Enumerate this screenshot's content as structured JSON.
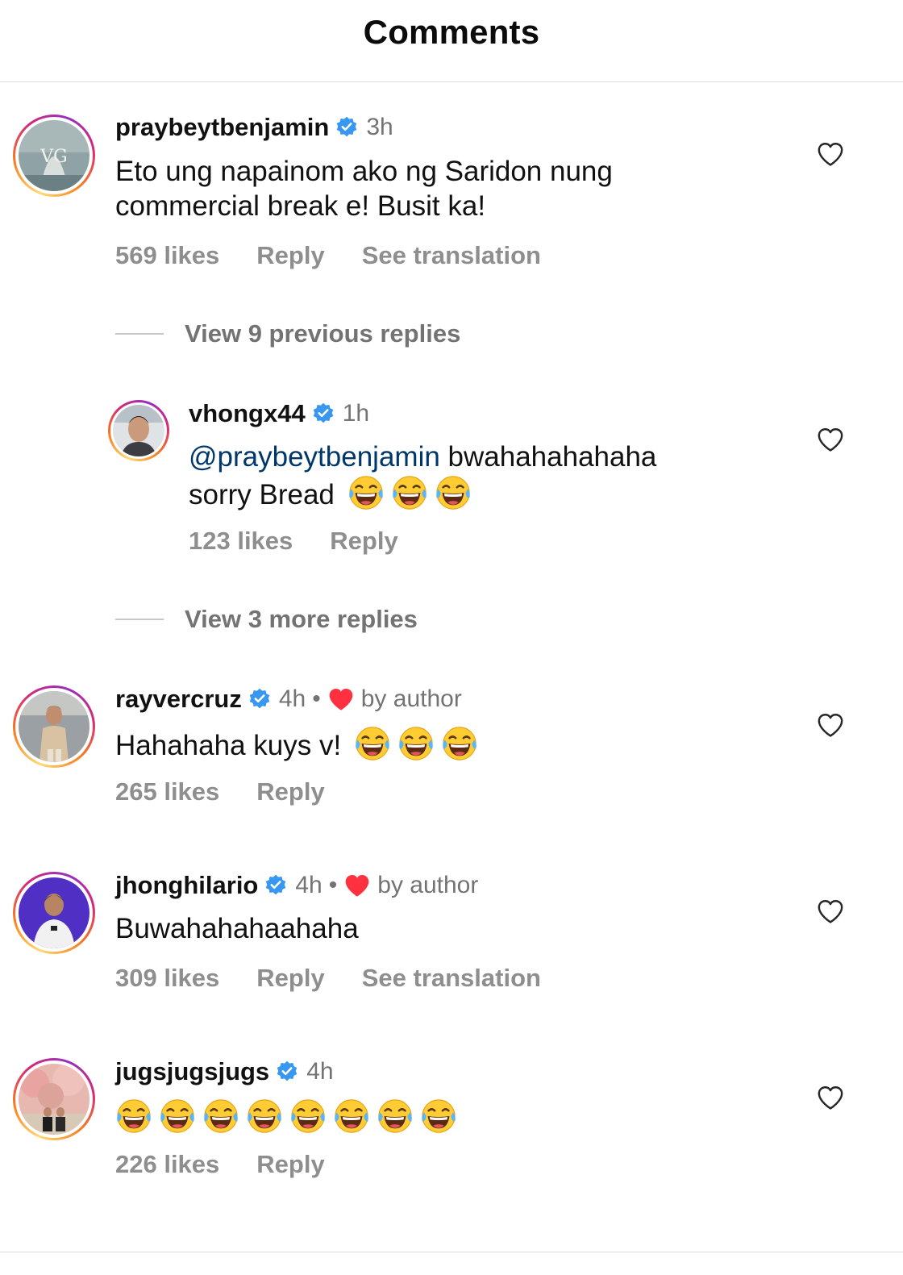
{
  "header": {
    "title": "Comments"
  },
  "comments": [
    {
      "username": "praybeytbenjamin",
      "time": "3h",
      "text": "Eto ung napainom ako ng Saridon nung commercial break e! Busit ka!",
      "text_line1": "Eto ung napainom ako ng Saridon nung",
      "text_line2": "commercial break e! Busit ka!",
      "likes": "569 likes",
      "reply": "Reply",
      "translation": "See translation"
    },
    {
      "view_previous": "View 9 previous replies"
    },
    {
      "username": "vhongx44",
      "time": "1h",
      "mention": "@praybeytbenjamin",
      "text_after_mention": " bwahahahahaha",
      "text_line2": "sorry Bread",
      "emoji_count": 3,
      "likes": "123 likes",
      "reply": "Reply"
    },
    {
      "view_more": "View 3 more replies"
    },
    {
      "username": "rayvercruz",
      "time": "4h",
      "dot": "•",
      "by_author": "by author",
      "text": "Hahahaha kuys v!",
      "emoji_count": 3,
      "likes": "265 likes",
      "reply": "Reply"
    },
    {
      "username": "jhonghilario",
      "time": "4h",
      "dot": "•",
      "by_author": "by author",
      "text": "Buwahahahaahaha",
      "likes": "309 likes",
      "reply": "Reply",
      "translation": "See translation"
    },
    {
      "username": "jugsjugsjugs",
      "time": "4h",
      "emoji_count": 8,
      "likes": "226 likes",
      "reply": "Reply"
    }
  ],
  "icons": {
    "verified": "verified-badge-icon",
    "like": "heart-outline-icon",
    "author_like": "heart-filled-icon",
    "emoji": "face-with-tears-of-joy-emoji"
  },
  "colors": {
    "verified": "#3897f0",
    "author_heart": "#ff3040",
    "mention": "#00376b",
    "secondary_text": "#737373"
  }
}
